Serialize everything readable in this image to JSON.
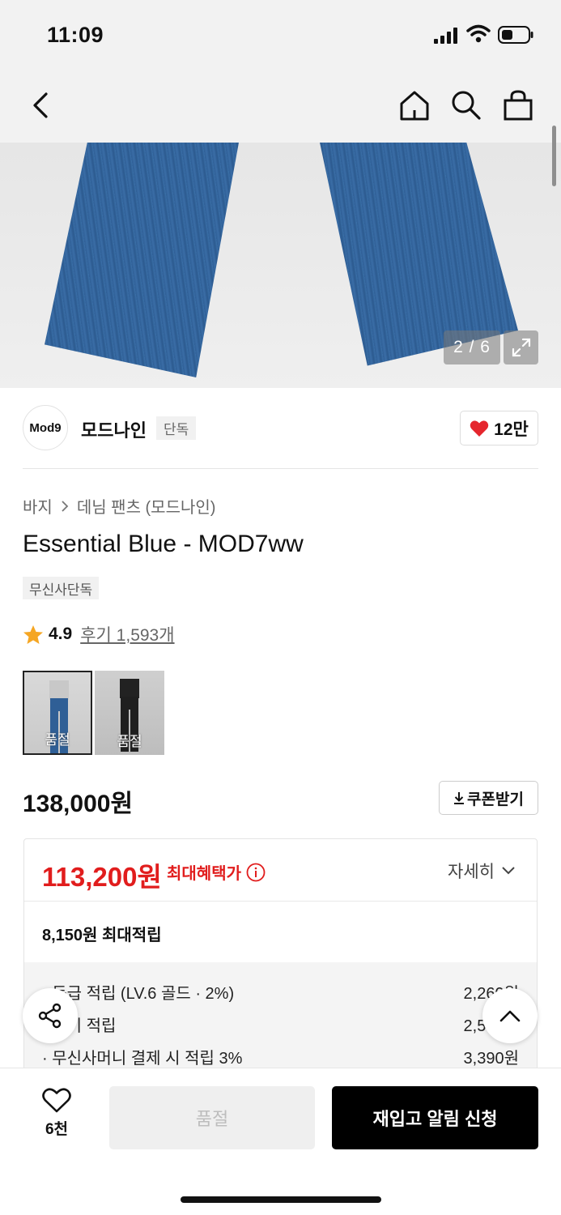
{
  "status": {
    "time": "11:09"
  },
  "gallery": {
    "page_indicator": "2 / 6"
  },
  "brand": {
    "logo_text": "Mod9",
    "name": "모드나인",
    "tag": "단독",
    "likes": "12만"
  },
  "breadcrumb": [
    "바지",
    "데님 팬츠 (모드나인)"
  ],
  "product": {
    "title": "Essential Blue - MOD7ww",
    "exclusive_tag": "무신사단독",
    "rating": "4.9",
    "review_text": "후기 1,593개",
    "swatches": [
      {
        "label": "품절",
        "color": "#2f5f96"
      },
      {
        "label": "품절",
        "color": "#1f1f1f"
      }
    ],
    "price": "138,000원",
    "coupon_label": "쿠폰받기"
  },
  "benefit": {
    "max_price": "113,200원",
    "max_label": "최대혜택가",
    "detail_label": "자세히",
    "points_title": "8,150원 최대적립",
    "rows": [
      {
        "label": "· 등급 적립 (LV.6 골드 · 2%)",
        "value": "2,260원"
      },
      {
        "label": "· 후기 적립",
        "value": "2,500원"
      },
      {
        "label": "· 무신사머니 결제 시 적립 3%",
        "value": "3,390원"
      }
    ]
  },
  "bottom": {
    "wish_count": "6천",
    "soldout_label": "품절",
    "restock_label": "재입고 알림 신청"
  },
  "colors": {
    "accent_red": "#e11d1d",
    "heart": "#e5262d",
    "primary_button": "#000000"
  }
}
